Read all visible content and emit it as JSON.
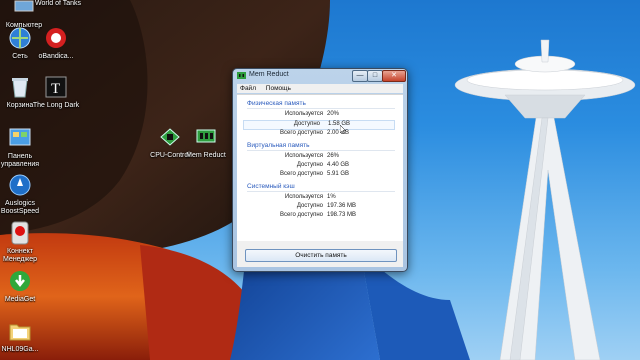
{
  "desktop": {
    "icons": [
      {
        "label": "Компьютер"
      },
      {
        "label": "World of Tanks"
      },
      {
        "label": "Сеть"
      },
      {
        "label": "oBandica..."
      },
      {
        "label": "Корзина"
      },
      {
        "label": "The Long Dark"
      },
      {
        "label": "Панель управления"
      },
      {
        "label": "Auslogics BoostSpeed"
      },
      {
        "label": "Коннект Менеджер"
      },
      {
        "label": "MediaGet"
      },
      {
        "label": "NHL09Ga..."
      },
      {
        "label": "CPU-Control"
      },
      {
        "label": "Mem Reduct"
      }
    ]
  },
  "window": {
    "title": "Mem Reduct",
    "minimize": "—",
    "maximize": "□",
    "close": "✕",
    "menu": [
      "Файл",
      "Помощь"
    ],
    "sections": [
      {
        "title": "Физическая память",
        "rows": [
          {
            "label": "Используется",
            "value": "20%"
          },
          {
            "label": "Доступно",
            "value": "1.58 GB"
          },
          {
            "label": "Всего доступно",
            "value": "2.00 GB"
          }
        ]
      },
      {
        "title": "Виртуальная память",
        "rows": [
          {
            "label": "Используется",
            "value": "26%"
          },
          {
            "label": "Доступно",
            "value": "4.40 GB"
          },
          {
            "label": "Всего доступно",
            "value": "5.91 GB"
          }
        ]
      },
      {
        "title": "Системный кэш",
        "rows": [
          {
            "label": "Используется",
            "value": "1%"
          },
          {
            "label": "Доступно",
            "value": "197.36 MB"
          },
          {
            "label": "Всего доступно",
            "value": "198.73 MB"
          }
        ]
      }
    ],
    "clean_button": "Очистить память"
  },
  "colors": {
    "section_title": "#2a5bbd",
    "title_bar": "#a9c4e2",
    "sky": "#2b8de0"
  }
}
